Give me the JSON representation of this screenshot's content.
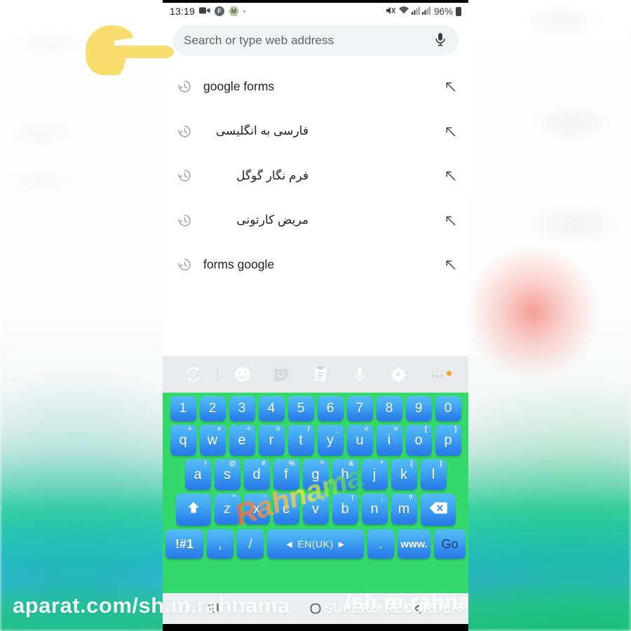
{
  "colors": {
    "keyboard_background": "#33d96a",
    "key_top": "#56bdf7",
    "key_bottom": "#2a7ae6",
    "toolbar_background": "#e9eaec",
    "searchbar_background": "#f1f3f4",
    "accent_dot": "#f5a623",
    "pointer_hand": "#f7dd6e"
  },
  "statusbar": {
    "time": "13:19",
    "icons_left": [
      "video-recorder-icon",
      "f-badge-icon",
      "m-badge-icon",
      "dot-icon"
    ],
    "badge_f": "F",
    "badge_m": "M",
    "icons_right": [
      "mute-icon",
      "wifi-icon",
      "signal-icon",
      "signal-icon"
    ],
    "battery_percent": "96%"
  },
  "search": {
    "placeholder": "Search or type web address",
    "value": "",
    "mic_icon": "microphone-icon"
  },
  "suggestions": [
    {
      "label": "google forms",
      "rtl": false,
      "icon": "history-icon",
      "action_icon": "arrow-up-left-icon"
    },
    {
      "label": "فارسی به انگلیسی",
      "rtl": true,
      "icon": "history-icon",
      "action_icon": "arrow-up-left-icon"
    },
    {
      "label": "فرم نگار گوگل",
      "rtl": true,
      "icon": "history-icon",
      "action_icon": "arrow-up-left-icon"
    },
    {
      "label": "مریض کارتونی",
      "rtl": true,
      "icon": "history-icon",
      "action_icon": "arrow-up-left-icon"
    },
    {
      "label": "forms google",
      "rtl": false,
      "icon": "history-icon",
      "action_icon": "arrow-up-left-icon"
    }
  ],
  "keyboard": {
    "toolbar": [
      {
        "name": "translate-icon"
      },
      {
        "name": "divider"
      },
      {
        "name": "emoji-icon"
      },
      {
        "name": "sticker-icon"
      },
      {
        "name": "clipboard-icon"
      },
      {
        "name": "microphone-icon"
      },
      {
        "name": "settings-gear-icon"
      },
      {
        "name": "more-options-icon"
      }
    ],
    "number_row": [
      "1",
      "2",
      "3",
      "4",
      "5",
      "6",
      "7",
      "8",
      "9",
      "0"
    ],
    "top_row": [
      {
        "key": "q",
        "sub": "+"
      },
      {
        "key": "w",
        "sub": "×"
      },
      {
        "key": "e",
        "sub": "÷"
      },
      {
        "key": "r",
        "sub": "="
      },
      {
        "key": "t",
        "sub": "/"
      },
      {
        "key": "y",
        "sub": "_"
      },
      {
        "key": "u",
        "sub": "<"
      },
      {
        "key": "i",
        "sub": ">"
      },
      {
        "key": "o",
        "sub": "["
      },
      {
        "key": "p",
        "sub": "]"
      }
    ],
    "home_row": [
      {
        "key": "a",
        "sub": "!"
      },
      {
        "key": "s",
        "sub": "@"
      },
      {
        "key": "d",
        "sub": "#"
      },
      {
        "key": "f",
        "sub": "%"
      },
      {
        "key": "g",
        "sub": "^"
      },
      {
        "key": "h",
        "sub": "&"
      },
      {
        "key": "j",
        "sub": "*"
      },
      {
        "key": "k",
        "sub": "("
      },
      {
        "key": "l",
        "sub": ")"
      }
    ],
    "bottom_row": [
      {
        "key": "z",
        "sub": "\""
      },
      {
        "key": "x",
        "sub": "'"
      },
      {
        "key": "c",
        "sub": ":"
      },
      {
        "key": "v",
        "sub": ";"
      },
      {
        "key": "b",
        "sub": "!"
      },
      {
        "key": "n",
        "sub": ","
      },
      {
        "key": "m",
        "sub": "?"
      }
    ],
    "shift_label": "shift-arrow-icon",
    "backspace_label": "backspace-icon",
    "function_row": {
      "symbols": "!#1",
      "comma": ",",
      "slash": "/",
      "space": "◄ EN(UK) ►",
      "period": ".",
      "www": "www.",
      "go": "Go"
    }
  },
  "navbar": {
    "recents_icon": "recents-icon",
    "home_icon": "home-icon",
    "back_icon": "back-icon"
  },
  "watermarks": {
    "aparat": "aparat.com/sh.m.rahnama",
    "rahnama": "Rahnama",
    "superb_recorder": "SUPERB RECORDER",
    "rahnama_nav": "/sh.m.rahnama"
  },
  "pointer": {
    "name": "pointing-hand-cursor"
  }
}
